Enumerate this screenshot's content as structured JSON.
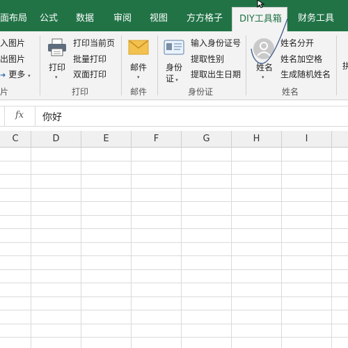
{
  "tabs": [
    {
      "label": "页面布局",
      "shown": "面布局"
    },
    {
      "label": "公式"
    },
    {
      "label": "数据"
    },
    {
      "label": "审阅"
    },
    {
      "label": "视图"
    },
    {
      "label": "方方格子"
    },
    {
      "label": "DIY工具箱",
      "active": true
    },
    {
      "label": "财务工具"
    }
  ],
  "ribbon": {
    "picture_group": {
      "items": [
        "导入图片",
        "导出图片",
        "更多"
      ],
      "shown": [
        "导入图片",
        "导出图片",
        "更多"
      ],
      "label": "图片"
    },
    "print_group": {
      "big_button": "打印",
      "items": [
        "打印当前页",
        "批量打印",
        "双面打印"
      ],
      "label": "打印"
    },
    "mail_group": {
      "big_button": "邮件",
      "label": "邮件"
    },
    "id_group": {
      "big_button_line1": "身份",
      "big_button_line2": "证",
      "items": [
        "输入身份证号",
        "提取性别",
        "提取出生日期"
      ],
      "label": "身份证"
    },
    "name_group": {
      "big_button": "姓名",
      "items": [
        "姓名分开",
        "姓名加空格",
        "生成随机姓名"
      ],
      "label": "姓名"
    },
    "next_group_partial": "拼"
  },
  "formula_bar": {
    "fx_label": "fx",
    "value": "你好"
  },
  "columns": [
    "C",
    "D",
    "E",
    "F",
    "G",
    "H",
    "I"
  ],
  "colors": {
    "tab_bar": "#217346",
    "ribbon": "#f3f3f3"
  }
}
